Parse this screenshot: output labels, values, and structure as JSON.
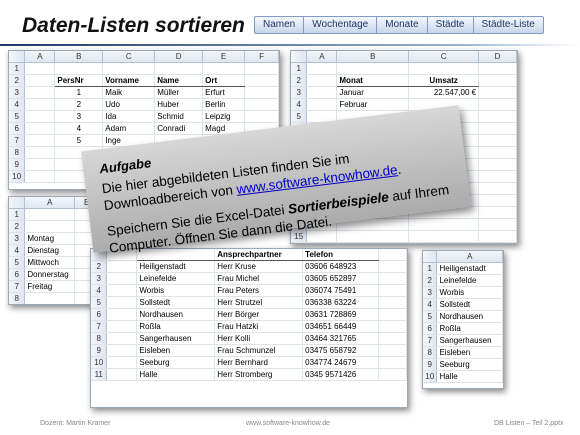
{
  "title": "Daten-Listen sortieren",
  "tabs": [
    "Namen",
    "Wochentage",
    "Monate",
    "Städte",
    "Städte-Liste"
  ],
  "sheet_names": {
    "cols": [
      "A",
      "B",
      "C",
      "D",
      "E",
      "F"
    ],
    "rows": [
      [
        "",
        "",
        "",
        "",
        "",
        ""
      ],
      [
        "",
        "PersNr",
        "Vorname",
        "Name",
        "Ort",
        ""
      ],
      [
        "",
        "1",
        "Maik",
        "Müller",
        "Erfurt",
        ""
      ],
      [
        "",
        "2",
        "Udo",
        "Huber",
        "Berlin",
        ""
      ],
      [
        "",
        "3",
        "Ida",
        "Schmid",
        "Leipzig",
        ""
      ],
      [
        "",
        "4",
        "Adam",
        "Conradi",
        "Magd",
        ""
      ],
      [
        "",
        "5",
        "Inge",
        "",
        "",
        ""
      ],
      [
        "",
        "",
        "",
        "",
        "",
        ""
      ],
      [
        "",
        "",
        "",
        "",
        "",
        ""
      ],
      [
        "",
        "",
        "",
        "",
        "",
        ""
      ]
    ]
  },
  "sheet_months": {
    "cols": [
      "A",
      "B",
      "C",
      "D"
    ],
    "rows": [
      [
        "",
        "",
        "",
        ""
      ],
      [
        "",
        "Monat",
        "Umsatz",
        ""
      ],
      [
        "",
        "Januar",
        "22.547,00 €",
        ""
      ],
      [
        "",
        "Februar",
        "",
        ""
      ],
      [
        "",
        "",
        "",
        ""
      ],
      [
        "",
        "",
        "",
        ""
      ],
      [
        "",
        "",
        "",
        ""
      ],
      [
        "",
        "",
        "",
        ""
      ],
      [
        "",
        "",
        "",
        ""
      ],
      [
        "",
        "",
        "",
        ""
      ],
      [
        "",
        "",
        "",
        ""
      ],
      [
        "",
        "",
        "",
        ""
      ],
      [
        "",
        "",
        "",
        ""
      ],
      [
        "",
        "",
        "",
        ""
      ],
      [
        "",
        "",
        "",
        ""
      ]
    ]
  },
  "sheet_weekdays": {
    "cols": [
      "A",
      "B"
    ],
    "rows": [
      [
        "",
        ""
      ],
      [
        "",
        ""
      ],
      [
        "Montag",
        ""
      ],
      [
        "Dienstag",
        ""
      ],
      [
        "Mittwoch",
        ""
      ],
      [
        "Donnerstag",
        ""
      ],
      [
        "Freitag",
        ""
      ],
      [
        "",
        ""
      ]
    ]
  },
  "sheet_cities": {
    "headers": [
      "",
      "Ansprechpartner",
      "Telefon"
    ],
    "rows": [
      [
        "Heiligenstadt",
        "Herr Kruse",
        "03606 648923"
      ],
      [
        "Leinefelde",
        "Frau Michel",
        "03605 652897"
      ],
      [
        "Worbis",
        "Frau Peters",
        "036074 75491"
      ],
      [
        "Sollstedt",
        "Herr Strutzel",
        "036338 63224"
      ],
      [
        "Nordhausen",
        "Herr Börger",
        "03631 728869"
      ],
      [
        "Roßla",
        "Frau Hatzki",
        "034651 66449"
      ],
      [
        "Sangerhausen",
        "Herr Kolli",
        "03464 321765"
      ],
      [
        "Eisleben",
        "Frau Schmunzel",
        "03475 658792"
      ],
      [
        "Seeburg",
        "Herr Bernhard",
        "034774 24679"
      ],
      [
        "Halle",
        "Herr Stromberg",
        "0345 9571426"
      ]
    ]
  },
  "sheet_citylist": {
    "col": "A",
    "items": [
      "Heiligenstadt",
      "Leinefelde",
      "Worbis",
      "Sollstedt",
      "Nordhausen",
      "Roßla",
      "Sangerhausen",
      "Eisleben",
      "Seeburg",
      "Halle"
    ]
  },
  "callout": {
    "heading": "Aufgabe",
    "line1_pre": "Die hier abgebildeten Listen finden Sie im Downloadbereich von ",
    "link": "www.software-knowhow.de",
    "line1_post": ".",
    "line2_pre": "Speichern Sie die Excel-Datei ",
    "file": "Sortierbeispiele",
    "line2_post": " auf Ihrem Computer. Öffnen Sie dann die Datei."
  },
  "footer": {
    "left": "Dozent: Martin Kramer",
    "center": "www.software-knowhow.de",
    "right": "DB Listen – Teil 2.pptx"
  }
}
